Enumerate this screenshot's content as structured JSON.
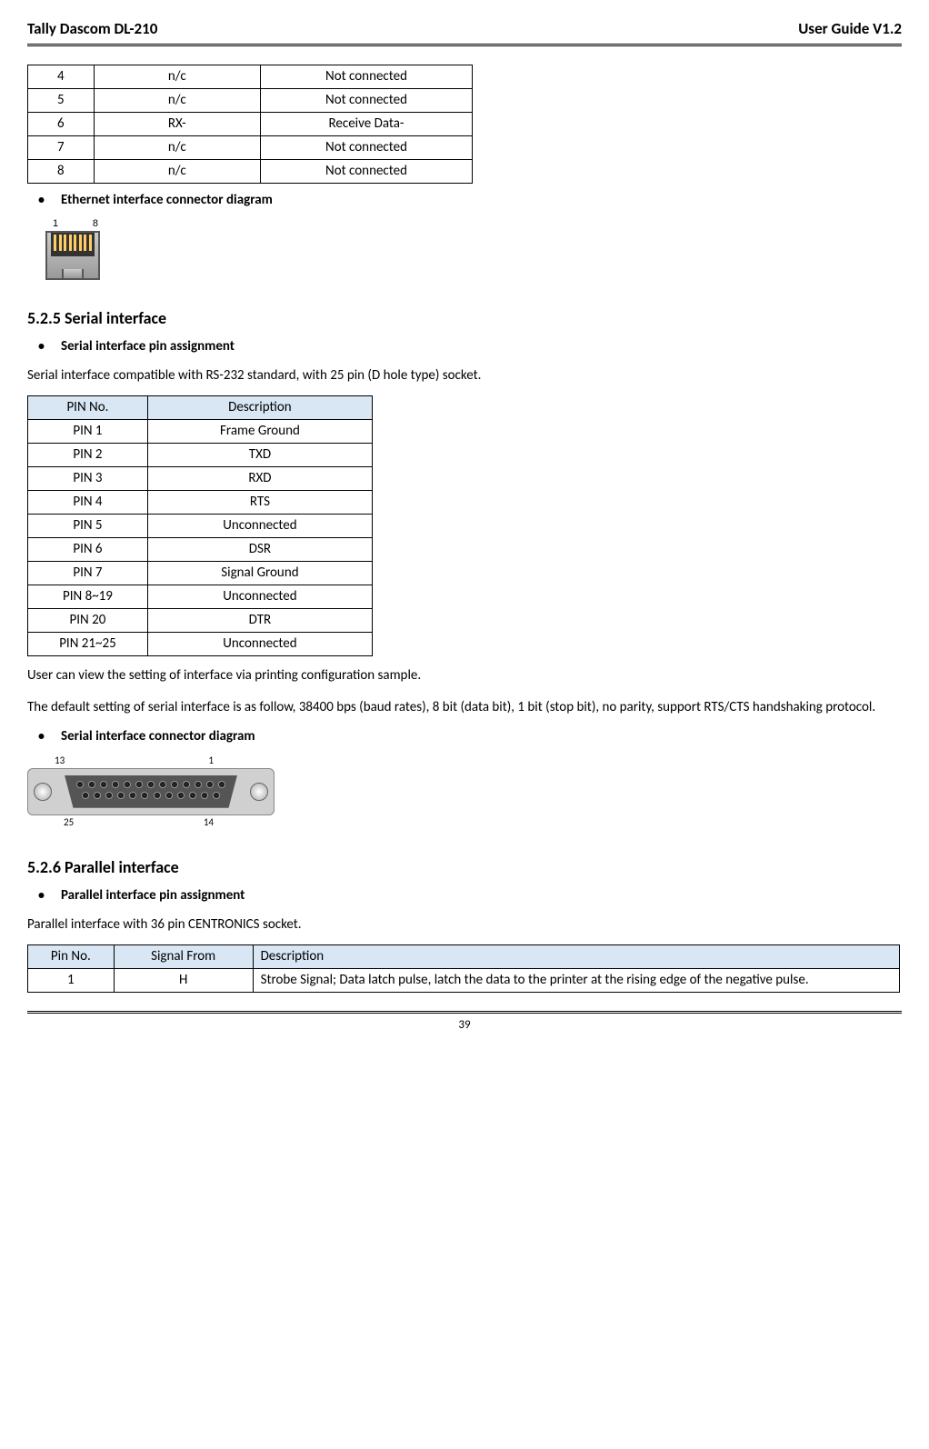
{
  "header": {
    "left": "Tally Dascom DL-210",
    "right": "User Guide V1.2"
  },
  "table1": {
    "rows": [
      {
        "c1": "4",
        "c2": "n/c",
        "c3": "Not connected"
      },
      {
        "c1": "5",
        "c2": "n/c",
        "c3": "Not connected"
      },
      {
        "c1": "6",
        "c2": "RX-",
        "c3": "Receive Data-"
      },
      {
        "c1": "7",
        "c2": "n/c",
        "c3": "Not connected"
      },
      {
        "c1": "8",
        "c2": "n/c",
        "c3": "Not connected"
      }
    ]
  },
  "bullet1": "Ethernet interface connector diagram",
  "rj45": {
    "left": "1",
    "right": "8"
  },
  "section525": {
    "heading": "5.2.5 Serial interface",
    "bullet": "Serial interface pin assignment",
    "intro": "Serial interface compatible with RS-232 standard, with 25 pin (D hole type) socket.",
    "table": {
      "headers": {
        "h1": "PIN No.",
        "h2": "Description"
      },
      "rows": [
        {
          "c1": "PIN 1",
          "c2": "Frame Ground"
        },
        {
          "c1": "PIN 2",
          "c2": "TXD"
        },
        {
          "c1": "PIN 3",
          "c2": "RXD"
        },
        {
          "c1": "PIN 4",
          "c2": "RTS"
        },
        {
          "c1": "PIN 5",
          "c2": "Unconnected"
        },
        {
          "c1": "PIN 6",
          "c2": "DSR"
        },
        {
          "c1": "PIN 7",
          "c2": "Signal Ground"
        },
        {
          "c1": "PIN 8~19",
          "c2": "Unconnected"
        },
        {
          "c1": "PIN 20",
          "c2": "DTR"
        },
        {
          "c1": "PIN 21~25",
          "c2": "Unconnected"
        }
      ]
    },
    "para1": "User can view the setting of interface via printing configuration sample.",
    "para2": "The default setting of serial interface is as follow, 38400 bps (baud rates), 8 bit (data bit), 1 bit (stop bit), no parity, support RTS/CTS handshaking protocol.",
    "bullet2": "Serial interface connector diagram"
  },
  "db25": {
    "tl": "13",
    "tr": "1",
    "bl": "25",
    "br": "14"
  },
  "section526": {
    "heading": "5.2.6 Parallel interface",
    "bullet": "Parallel interface pin assignment",
    "intro": "Parallel interface with 36 pin CENTRONICS socket.",
    "table": {
      "headers": {
        "h1": "Pin No.",
        "h2": "Signal From",
        "h3": "Description"
      },
      "rows": [
        {
          "c1": "1",
          "c2": "H",
          "c3": "Strobe Signal; Data latch pulse, latch the data to the printer at the rising edge of the negative pulse."
        }
      ]
    }
  },
  "footer": {
    "page": "39"
  }
}
